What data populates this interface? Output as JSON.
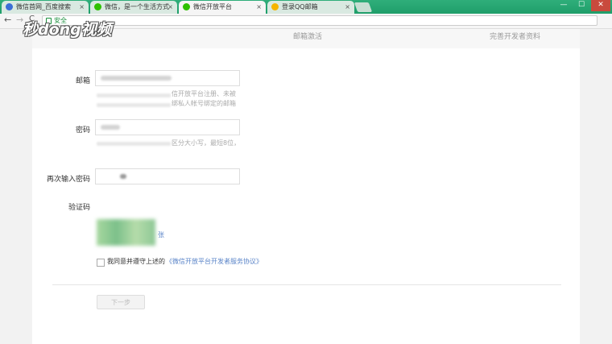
{
  "browser": {
    "tabs": [
      {
        "title": "微信首网_百度搜索",
        "favicon": "baidu-icon",
        "active": false
      },
      {
        "title": "微信，是一个生活方式",
        "favicon": "wechat-icon",
        "active": false
      },
      {
        "title": "微信开放平台",
        "favicon": "wechat-icon",
        "active": true
      },
      {
        "title": "登录QQ邮箱",
        "favicon": "qq-mail-icon",
        "active": false
      }
    ],
    "close_glyph": "×",
    "window_controls": {
      "minimize": "—",
      "maximize": "☐",
      "close": "✕"
    },
    "nav": {
      "back": "←",
      "forward": "→",
      "reload": "C"
    },
    "address": {
      "secure_label": "安全"
    }
  },
  "watermark": {
    "text": "秒dong视频"
  },
  "steps": {
    "step2": "邮箱激活",
    "step3": "完善开发者资料"
  },
  "form": {
    "email_label": "邮箱",
    "email_hint_visible": "信开放平台注册、未被\n绑私人帐号绑定的邮箱",
    "password_label": "密码",
    "password_hint_visible": "区分大小写，最短8位，",
    "confirm_label": "再次输入密码",
    "captcha_label": "验证码",
    "captcha_swap": "张",
    "agree_text": "我同意并遵守上述的",
    "agree_link": "《微信开放平台开发者服务协议》",
    "next_button": "下一步"
  },
  "colors": {
    "tab_strip": "#22a36e",
    "link": "#5a84c8",
    "secure": "#1a8f3c"
  }
}
